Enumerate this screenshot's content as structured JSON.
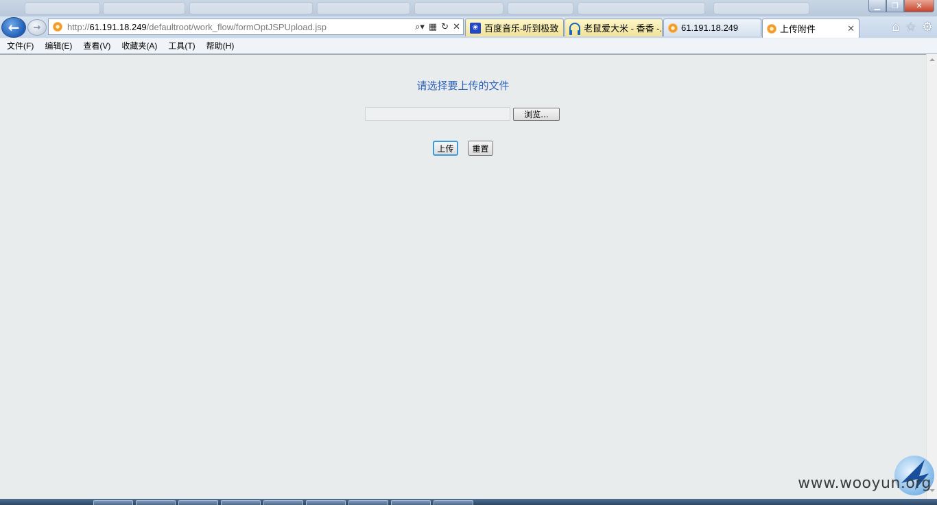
{
  "browser": {
    "address_prefix": "http://",
    "address_host": "61.191.18.249",
    "address_path": "/defaultroot/work_flow/formOptJSPUpload.jsp",
    "tabs": [
      {
        "title": "百度音乐-听到极致",
        "icon": "paw-icon",
        "style": "yellow"
      },
      {
        "title": "老鼠爱大米 - 香香 -...",
        "icon": "headphone-icon",
        "style": "yellow"
      },
      {
        "title": "61.191.18.249",
        "icon": "orange-page-icon",
        "style": "normal"
      },
      {
        "title": "上传附件",
        "icon": "orange-page-icon",
        "style": "active"
      }
    ]
  },
  "menubar": {
    "items": [
      "文件(F)",
      "编辑(E)",
      "查看(V)",
      "收藏夹(A)",
      "工具(T)",
      "帮助(H)"
    ]
  },
  "page": {
    "heading": "请选择要上传的文件",
    "browse_label": "浏览...",
    "upload_label": "上传",
    "reset_label": "重置"
  },
  "watermark": {
    "text": "www.wooyun.org"
  },
  "colors": {
    "heading": "#2f63bd",
    "page_background": "#e8ecec",
    "chrome": "#c6d6ea"
  }
}
